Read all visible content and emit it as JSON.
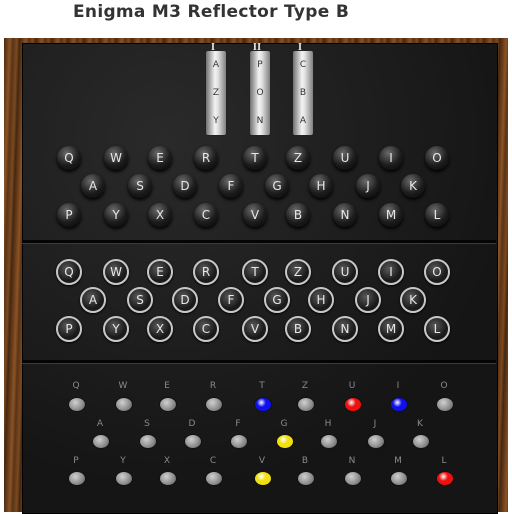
{
  "window": {
    "title": "Enigma M3 Reflector Type B"
  },
  "rotors": [
    {
      "roman": "I",
      "letters": [
        "A",
        "Z",
        "Y"
      ]
    },
    {
      "roman": "II",
      "letters": [
        "P",
        "O",
        "N"
      ]
    },
    {
      "roman": "I",
      "letters": [
        "C",
        "B",
        "A"
      ]
    }
  ],
  "keyboard_rows": [
    [
      "Q",
      "W",
      "E",
      "R",
      "T",
      "Z",
      "U",
      "I",
      "O"
    ],
    [
      "A",
      "S",
      "D",
      "F",
      "G",
      "H",
      "J",
      "K"
    ],
    [
      "P",
      "Y",
      "X",
      "C",
      "V",
      "B",
      "N",
      "M",
      "L"
    ]
  ],
  "plugboard_rows": [
    [
      "Q",
      "W",
      "E",
      "R",
      "T",
      "Z",
      "U",
      "I",
      "O"
    ],
    [
      "A",
      "S",
      "D",
      "F",
      "G",
      "H",
      "J",
      "K"
    ],
    [
      "P",
      "Y",
      "X",
      "C",
      "V",
      "B",
      "N",
      "M",
      "L"
    ]
  ],
  "lampboard_rows": [
    [
      {
        "label": "Q",
        "color": "#a0a0a0"
      },
      {
        "label": "W",
        "color": "#a0a0a0"
      },
      {
        "label": "E",
        "color": "#a0a0a0"
      },
      {
        "label": "R",
        "color": "#a0a0a0"
      },
      {
        "label": "T",
        "color": "#1010ee"
      },
      {
        "label": "Z",
        "color": "#a0a0a0"
      },
      {
        "label": "U",
        "color": "#ee1010"
      },
      {
        "label": "I",
        "color": "#1010ee"
      },
      {
        "label": "O",
        "color": "#a0a0a0"
      }
    ],
    [
      {
        "label": "A",
        "color": "#a0a0a0"
      },
      {
        "label": "S",
        "color": "#a0a0a0"
      },
      {
        "label": "D",
        "color": "#a0a0a0"
      },
      {
        "label": "F",
        "color": "#a0a0a0"
      },
      {
        "label": "G",
        "color": "#f0e010"
      },
      {
        "label": "H",
        "color": "#a0a0a0"
      },
      {
        "label": "J",
        "color": "#a0a0a0"
      },
      {
        "label": "K",
        "color": "#a0a0a0"
      }
    ],
    [
      {
        "label": "P",
        "color": "#a0a0a0"
      },
      {
        "label": "Y",
        "color": "#a0a0a0"
      },
      {
        "label": "X",
        "color": "#a0a0a0"
      },
      {
        "label": "C",
        "color": "#a0a0a0"
      },
      {
        "label": "V",
        "color": "#f0e010"
      },
      {
        "label": "B",
        "color": "#a0a0a0"
      },
      {
        "label": "N",
        "color": "#a0a0a0"
      },
      {
        "label": "M",
        "color": "#a0a0a0"
      },
      {
        "label": "L",
        "color": "#ee1010"
      }
    ]
  ]
}
